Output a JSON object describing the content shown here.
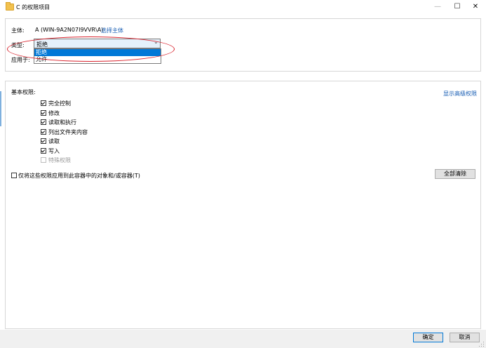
{
  "window": {
    "title": "C 的权限项目",
    "minimize_glyph": "—",
    "maximize_glyph": "☐",
    "close_glyph": "✕"
  },
  "principal": {
    "label": "主体:",
    "value": "A (WIN-9A2N07I9VVR\\A)",
    "select_link": "选择主体"
  },
  "type": {
    "label": "类型:",
    "selected": "拒绝",
    "options": [
      "拒绝",
      "允许"
    ]
  },
  "applies_to": {
    "label": "应用于:"
  },
  "permissions": {
    "label": "基本权限:",
    "show_advanced_link": "显示高级权限",
    "items": [
      {
        "label": "完全控制",
        "checked": true,
        "disabled": false
      },
      {
        "label": "修改",
        "checked": true,
        "disabled": false
      },
      {
        "label": "读取和执行",
        "checked": true,
        "disabled": false
      },
      {
        "label": "列出文件夹内容",
        "checked": true,
        "disabled": false
      },
      {
        "label": "读取",
        "checked": true,
        "disabled": false
      },
      {
        "label": "写入",
        "checked": true,
        "disabled": false
      },
      {
        "label": "特殊权限",
        "checked": false,
        "disabled": true
      }
    ],
    "apply_only_label": "仅将这些权限应用到此容器中的对象和/或容器(T)",
    "apply_only_checked": false,
    "clear_all_button": "全部清除"
  },
  "footer": {
    "ok_button": "确定",
    "cancel_button": "取消"
  },
  "colors": {
    "accent": "#0078d7",
    "link": "#1a5fb4",
    "highlight_ellipse": "#d9232d"
  }
}
